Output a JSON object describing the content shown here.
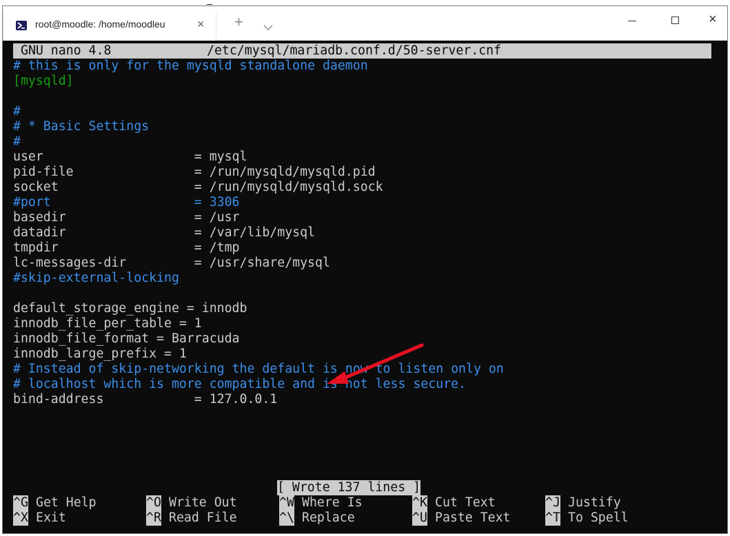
{
  "window": {
    "tab_title": "root@moodle: /home/moodleu",
    "tab_close_glyph": "×",
    "new_tab_glyph": "+",
    "close_glyph": "×"
  },
  "nano": {
    "version": "GNU nano 4.8",
    "filename": "/etc/mysql/mariadb.conf.d/50-server.cnf",
    "lines": [
      "# this is only for the mysqld standalone daemon",
      "[mysqld]",
      "",
      "#",
      "# * Basic Settings",
      "#",
      "user                    = mysql",
      "pid-file                = /run/mysqld/mysqld.pid",
      "socket                  = /run/mysqld/mysqld.sock",
      "#port                   = 3306",
      "basedir                 = /usr",
      "datadir                 = /var/lib/mysql",
      "tmpdir                  = /tmp",
      "lc-messages-dir         = /usr/share/mysql",
      "#skip-external-locking",
      "",
      "default_storage_engine = innodb",
      "innodb_file_per_table = 1",
      "innodb_file_format = Barracuda",
      "innodb_large_prefix = 1",
      "# Instead of skip-networking the default is now to listen only on",
      "# localhost which is more compatible and is not less secure.",
      "bind-address            = 127.0.0.1"
    ],
    "status_message": "[ Wrote 137 lines ]",
    "shortcuts_row1": [
      {
        "key": "^G",
        "label": "Get Help"
      },
      {
        "key": "^O",
        "label": "Write Out"
      },
      {
        "key": "^W",
        "label": "Where Is"
      },
      {
        "key": "^K",
        "label": "Cut Text"
      },
      {
        "key": "^J",
        "label": "Justify"
      }
    ],
    "shortcuts_row2": [
      {
        "key": "^X",
        "label": "Exit"
      },
      {
        "key": "^R",
        "label": "Read File"
      },
      {
        "key": "^\\",
        "label": "Replace"
      },
      {
        "key": "^U",
        "label": "Paste Text"
      },
      {
        "key": "^T",
        "label": "To Spell"
      }
    ]
  },
  "colors": {
    "terminal_bg": "#0c0c0c",
    "text": "#cccccc",
    "comment_blue": "#3b8eea",
    "section_green": "#13a10e",
    "arrow_red": "#e81123"
  }
}
